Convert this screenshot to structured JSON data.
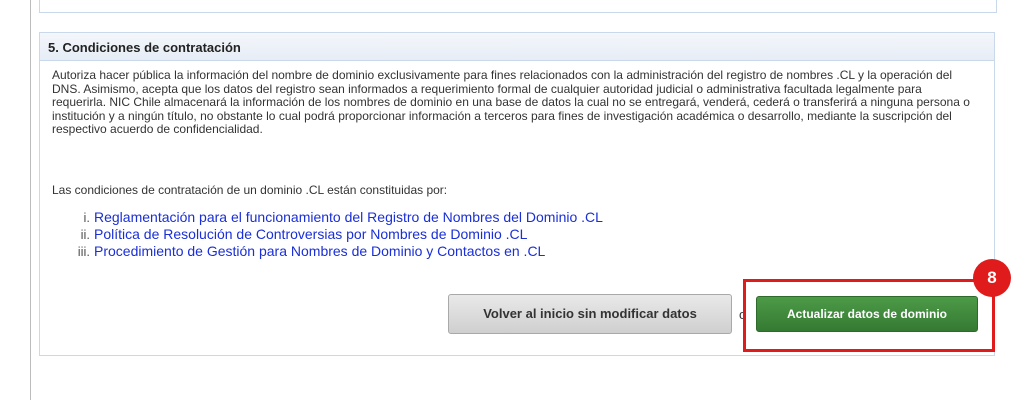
{
  "section": {
    "title": "5. Condiciones de contratación",
    "paragraph": "Autoriza hacer pública la información del nombre de dominio exclusivamente para fines relacionados con la administración del registro de nombres .CL y la operación del DNS. Asimismo, acepta que los datos del registro sean informados a requerimiento formal de cualquier autoridad judicial o administrativa facultada legalmente para requerirla. NIC Chile almacenará la información de los nombres de dominio en una base de datos la cual no se entregará, venderá, cederá o transferirá a ninguna persona o institución y a ningún título, no obstante lo cual podrá proporcionar información a terceros para fines de investigación académica o desarrollo, mediante la suscripción del respectivo acuerdo de confidencialidad.",
    "intro": "Las condiciones de contratación de un dominio .CL están constituidas por:",
    "documents": [
      {
        "num": "i.",
        "label": "Reglamentación para el funcionamiento del Registro de Nombres del Dominio .CL"
      },
      {
        "num": "ii.",
        "label": "Política de Resolución de Controversias por Nombres de Dominio .CL"
      },
      {
        "num": "iii.",
        "label": "Procedimiento de Gestión para Nombres de Dominio y Contactos en .CL"
      }
    ]
  },
  "actions": {
    "back_label": "Volver al inicio sin modificar datos",
    "separator": "o",
    "update_label": "Actualizar datos de dominio"
  },
  "annotation": {
    "step_number": "8",
    "color": "#e01b1b"
  },
  "colors": {
    "link": "#1a2fd6",
    "update_button": "#3f8a3b"
  }
}
